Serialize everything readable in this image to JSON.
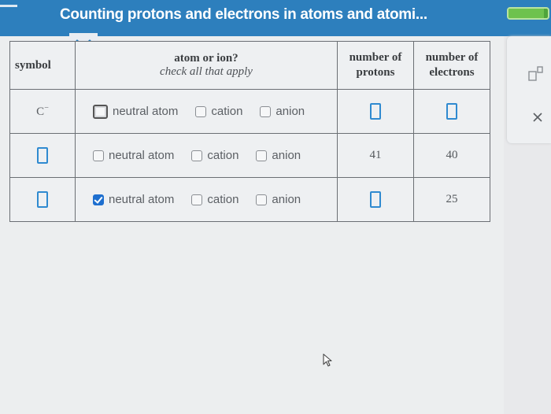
{
  "header": {
    "title": "Counting protons and electrons in atoms and atomi...",
    "progress_fraction": 0.9
  },
  "table": {
    "headers": {
      "symbol": "symbol",
      "atom_or_ion": "atom or ion?",
      "check_all": "check all that apply",
      "protons_line1": "number of",
      "protons_line2": "protons",
      "electrons_line1": "number of",
      "electrons_line2": "electrons"
    },
    "options": [
      "neutral atom",
      "cation",
      "anion"
    ],
    "rows": [
      {
        "symbol": "C",
        "symbol_super": "−",
        "protons": "",
        "electrons": "",
        "neutral_checked": false
      },
      {
        "symbol": "",
        "protons": "41",
        "electrons": "40",
        "neutral_checked": false
      },
      {
        "symbol": "",
        "protons": "",
        "electrons": "25",
        "neutral_checked": true
      }
    ]
  },
  "colors": {
    "header_blue": "#2d7fbd",
    "input_box_blue": "#2f8ad0",
    "check_blue": "#1e6fcf"
  },
  "icons": [
    "chevron-down-icon",
    "superscript-subscript-icon",
    "close-icon",
    "mouse-cursor-icon"
  ]
}
